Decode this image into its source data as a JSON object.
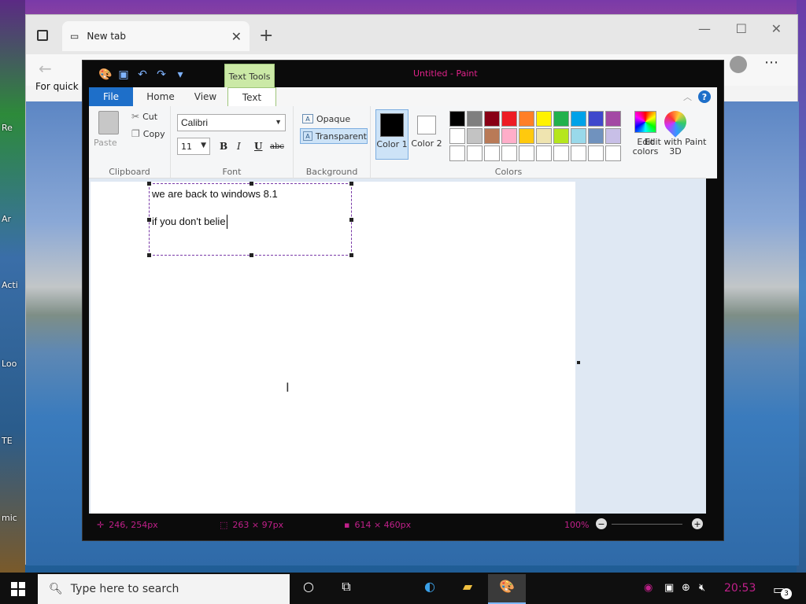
{
  "desktop": {
    "icon_labels": [
      "Re",
      "Ar",
      "Acti",
      "Loo",
      "TE",
      "mic"
    ]
  },
  "browser": {
    "tab_title": "New tab",
    "favorites_text": "For quick a"
  },
  "paint": {
    "window_title": "Untitled - Paint",
    "contextual_tab": "Text Tools",
    "tabs": {
      "file": "File",
      "home": "Home",
      "view": "View",
      "text": "Text"
    },
    "clipboard": {
      "paste": "Paste",
      "cut": "Cut",
      "copy": "Copy",
      "group_label": "Clipboard"
    },
    "font": {
      "family": "Calibri",
      "size": "11",
      "bold": "B",
      "italic": "I",
      "underline": "U",
      "strikethrough": "abc",
      "group_label": "Font"
    },
    "background": {
      "opaque": "Opaque",
      "transparent": "Transparent",
      "group_label": "Background"
    },
    "colors": {
      "color1_label": "Color 1",
      "color2_label": "Color 2",
      "edit_colors": "Edit colors",
      "group_label": "Colors",
      "palette": [
        "#000000",
        "#7f7f7f",
        "#880015",
        "#ed1c24",
        "#ff7f27",
        "#fff200",
        "#22b14c",
        "#00a2e8",
        "#3f48cc",
        "#a349a4",
        "#ffffff",
        "#c3c3c3",
        "#b97a57",
        "#ffaec9",
        "#ffc90e",
        "#efe4b0",
        "#b5e61d",
        "#99d9ea",
        "#7092be",
        "#c8bfe7",
        "#ffffff",
        "#ffffff",
        "#ffffff",
        "#ffffff",
        "#ffffff",
        "#ffffff",
        "#ffffff",
        "#ffffff",
        "#ffffff",
        "#ffffff"
      ]
    },
    "paint3d": "Edit with Paint 3D",
    "canvas_text": {
      "line1": "we are back to windows 8.1",
      "line2": "if you don't belie"
    },
    "status": {
      "cursor": "246, 254px",
      "selection": "263 × 97px",
      "size": "614 × 460px",
      "zoom": "100%"
    }
  },
  "taskbar": {
    "search_placeholder": "Type here to search",
    "time": "20:53",
    "notification_count": "3"
  }
}
